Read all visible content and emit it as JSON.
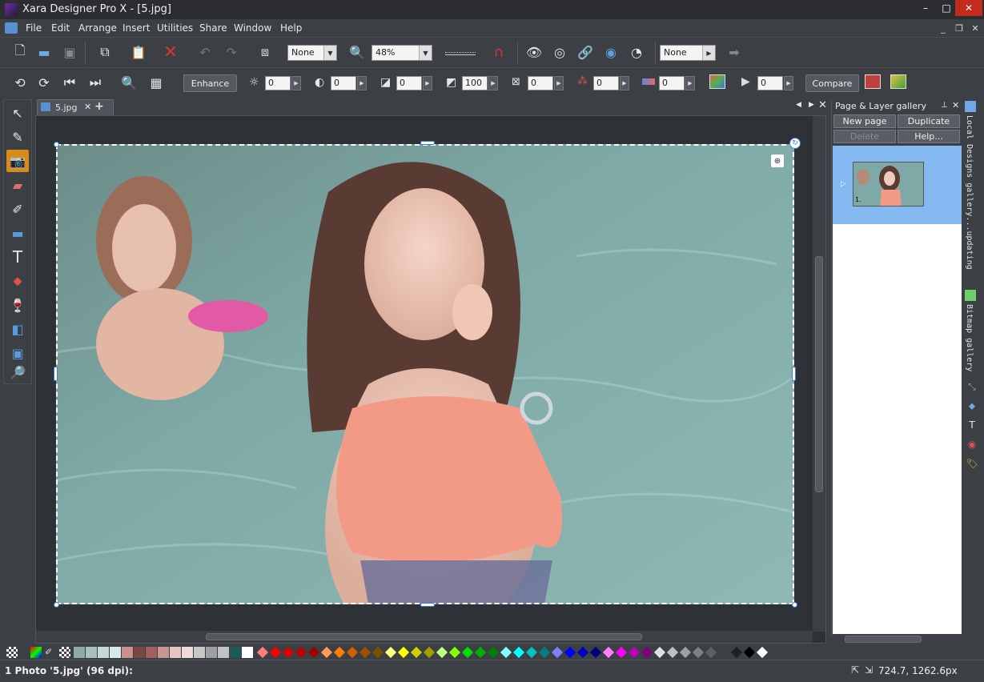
{
  "window": {
    "title": "Xara Designer Pro X - [5.jpg]",
    "controls": {
      "minimize": "–",
      "maximize": "□",
      "close": "✕"
    }
  },
  "menu": {
    "items": [
      "File",
      "Edit",
      "Arrange",
      "Insert",
      "Utilities",
      "Share",
      "Window",
      "Help"
    ]
  },
  "toolbar1": {
    "quality_combo": "None",
    "zoom_combo": "48%",
    "feather_combo": "None"
  },
  "toolbar2": {
    "enhance_label": "Enhance",
    "brightness": "0",
    "contrast": "0",
    "gamma": "0",
    "saturation": "100",
    "sharpen": "0",
    "rgb": "0",
    "temperature": "0",
    "blur": "0",
    "compare_label": "Compare"
  },
  "document": {
    "tab_name": "5.jpg",
    "add_tab": "+"
  },
  "gallery": {
    "title": "Page & Layer gallery",
    "buttons": {
      "new_page": "New page",
      "duplicate": "Duplicate",
      "delete": "Delete",
      "help": "Help..."
    },
    "page_label": "1."
  },
  "side_tabs": {
    "local_designs": "Local Designs gallery...updating",
    "bitmap": "Bitmap gallery"
  },
  "status": {
    "message": "1 Photo '5.jpg' (96 dpi):",
    "coordinates": "724.7, 1262.6px"
  },
  "palette": {
    "swatches": [
      "#8faaa8",
      "#a7c1c0",
      "#c7d8d8",
      "#d9e8e8",
      "#cf8f8c",
      "#7a4747",
      "#a06060",
      "#c99494",
      "#e8c3c3",
      "#f2d9d9",
      "#c8c8c8",
      "#a0a0a0",
      "#c2c2c2",
      "#1d5a5a",
      "#ffffff"
    ],
    "diamonds": [
      "#ff7d7d",
      "#ff0000",
      "#e00000",
      "#c00000",
      "#a00000",
      "#ff9a5a",
      "#ff8000",
      "#d06000",
      "#a05000",
      "#805000",
      "#ffff80",
      "#ffff00",
      "#d0d000",
      "#a0a000",
      "#c0ff80",
      "#80ff00",
      "#00e000",
      "#00b000",
      "#008000",
      "#80ffff",
      "#00ffff",
      "#00c0c0",
      "#008080",
      "#8080ff",
      "#0000ff",
      "#0000c0",
      "#000080",
      "#ff80ff",
      "#ff00ff",
      "#c000c0",
      "#800080",
      "#e0e0e0",
      "#c0c0c0",
      "#a0a0a0",
      "#808080",
      "#606060",
      "#404040",
      "#202020",
      "#000000",
      "#ffffff"
    ]
  }
}
